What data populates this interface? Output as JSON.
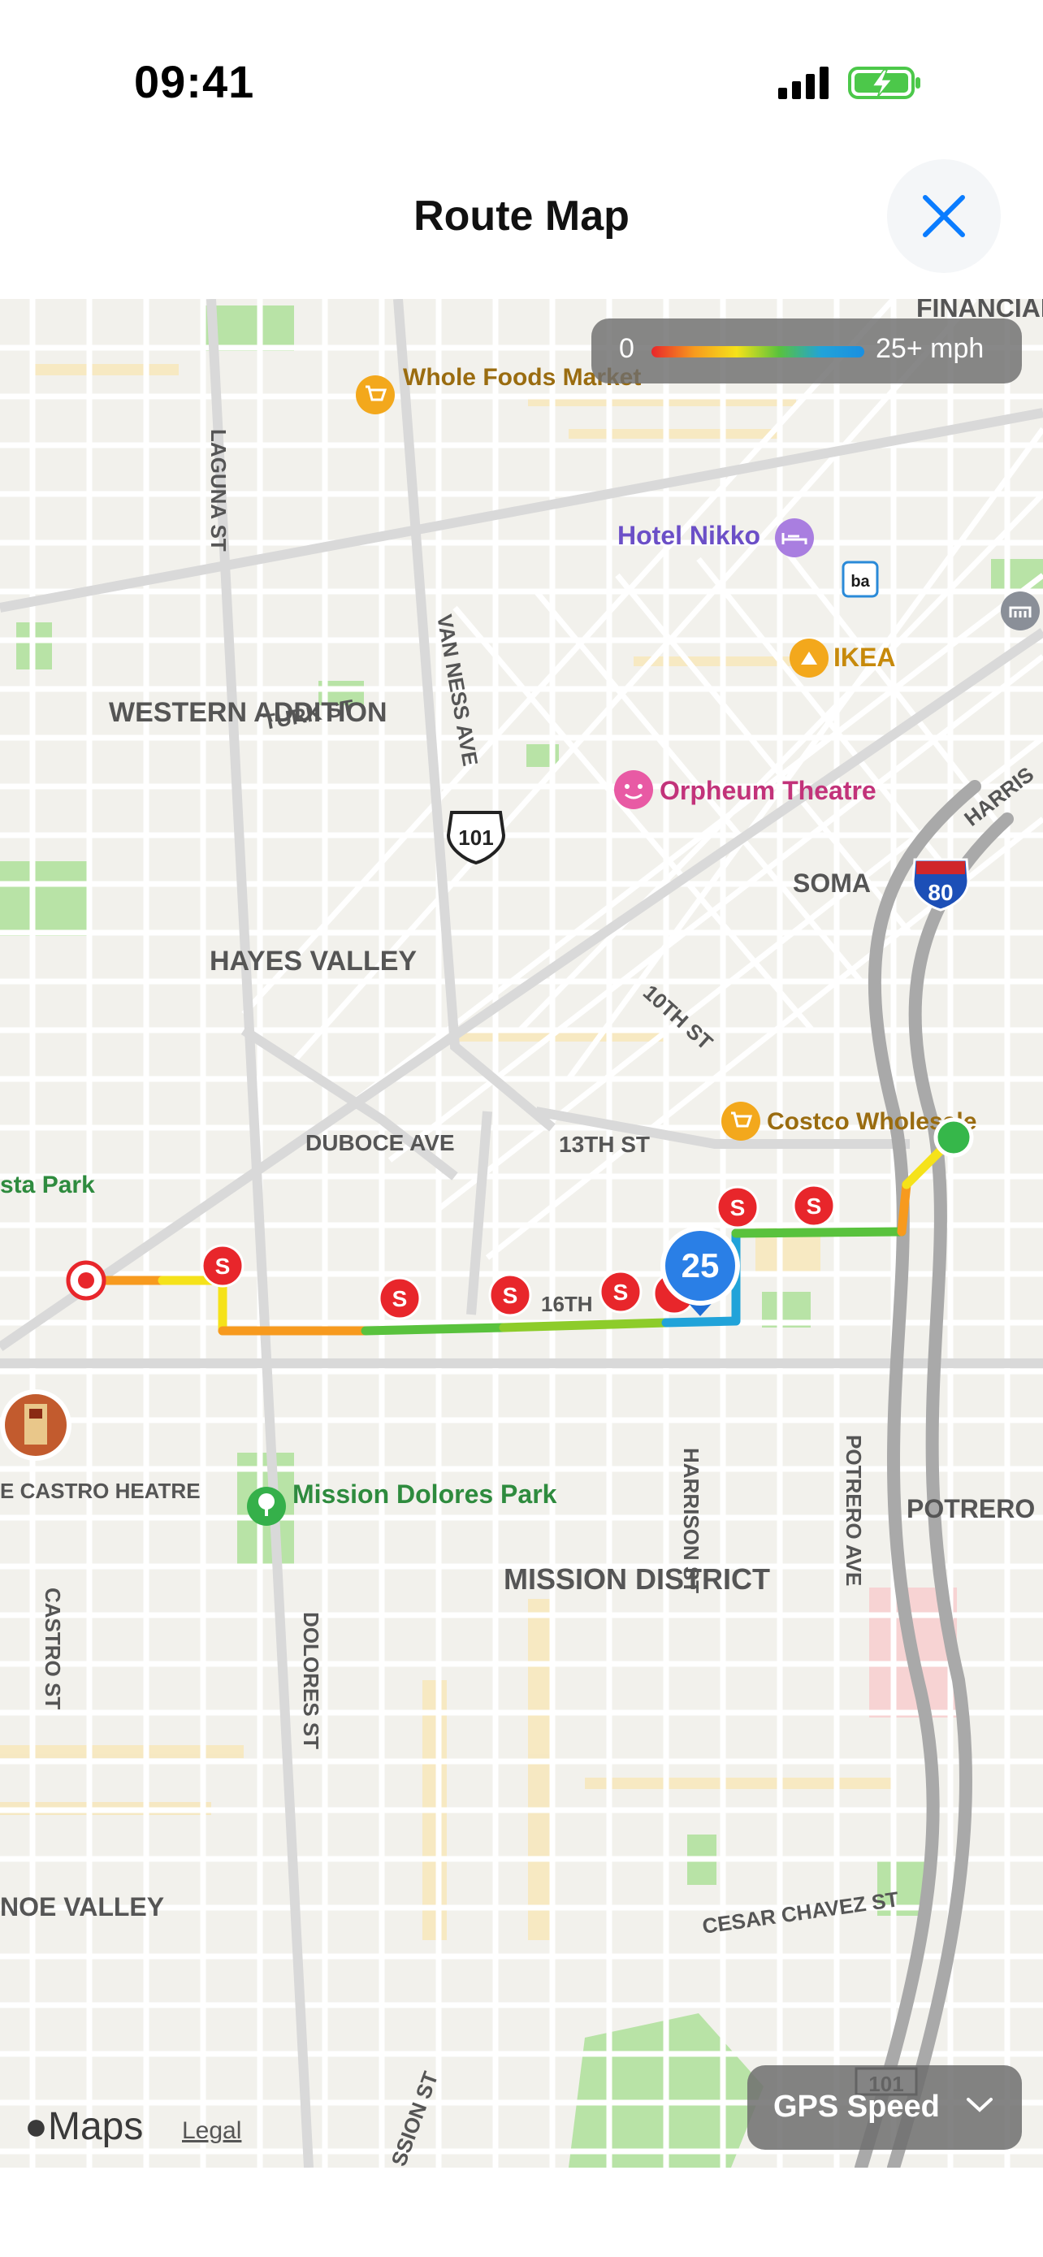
{
  "status_bar": {
    "time": "09:41"
  },
  "header": {
    "title": "Route Map"
  },
  "map": {
    "labels": {
      "financial_district": "FINANCIAL DISTRICT",
      "whole_foods": "Whole Foods Market",
      "laguna_st": "LAGUNA ST",
      "hotel_nikko": "Hotel Nikko",
      "ikea": "IKEA",
      "western_addition": "WESTERN ADDITION",
      "turk_st": "TURK ST",
      "van_ness_ave": "VAN NESS AVE",
      "hwy_101": "101",
      "orpheum": "Orpheum Theatre",
      "soma": "SOMA",
      "i80": "80",
      "harrison_top": "HARRIS",
      "hayes_valley": "HAYES VALLEY",
      "tenth_st": "10TH ST",
      "costco": "Costco Wholesale",
      "duboce_ave": "DUBOCE AVE",
      "thirteenth_st": "13TH ST",
      "sta_park": "sta Park",
      "sixteenth_st": "16TH",
      "castro_theatre": "E CASTRO HEATRE",
      "mission_dolores_park": "Mission Dolores Park",
      "harrison_st": "HARRISON ST",
      "potrero_ave": "POTRERO AVE",
      "potrero_hill": "POTRERO H",
      "mission_district": "MISSION DISTRICT",
      "castro_st": "CASTRO ST",
      "dolores_st": "DOLORES ST",
      "noe_valley": "NOE VALLEY",
      "cesar_chavez": "CESAR CHAVEZ ST",
      "hwy_101_bottom": "101",
      "mission_st": "SSION ST"
    },
    "speed_bubble": "25",
    "stop_marker_label": "S",
    "legend": {
      "min": "0",
      "max": "25+ mph"
    },
    "speed_colors": [
      "#e8262b",
      "#f79a1e",
      "#f5e21a",
      "#59c23d",
      "#21a3d9"
    ],
    "branding": {
      "logo": "Maps",
      "legal": "Legal"
    },
    "metric_selector": {
      "label": "GPS Speed"
    }
  }
}
